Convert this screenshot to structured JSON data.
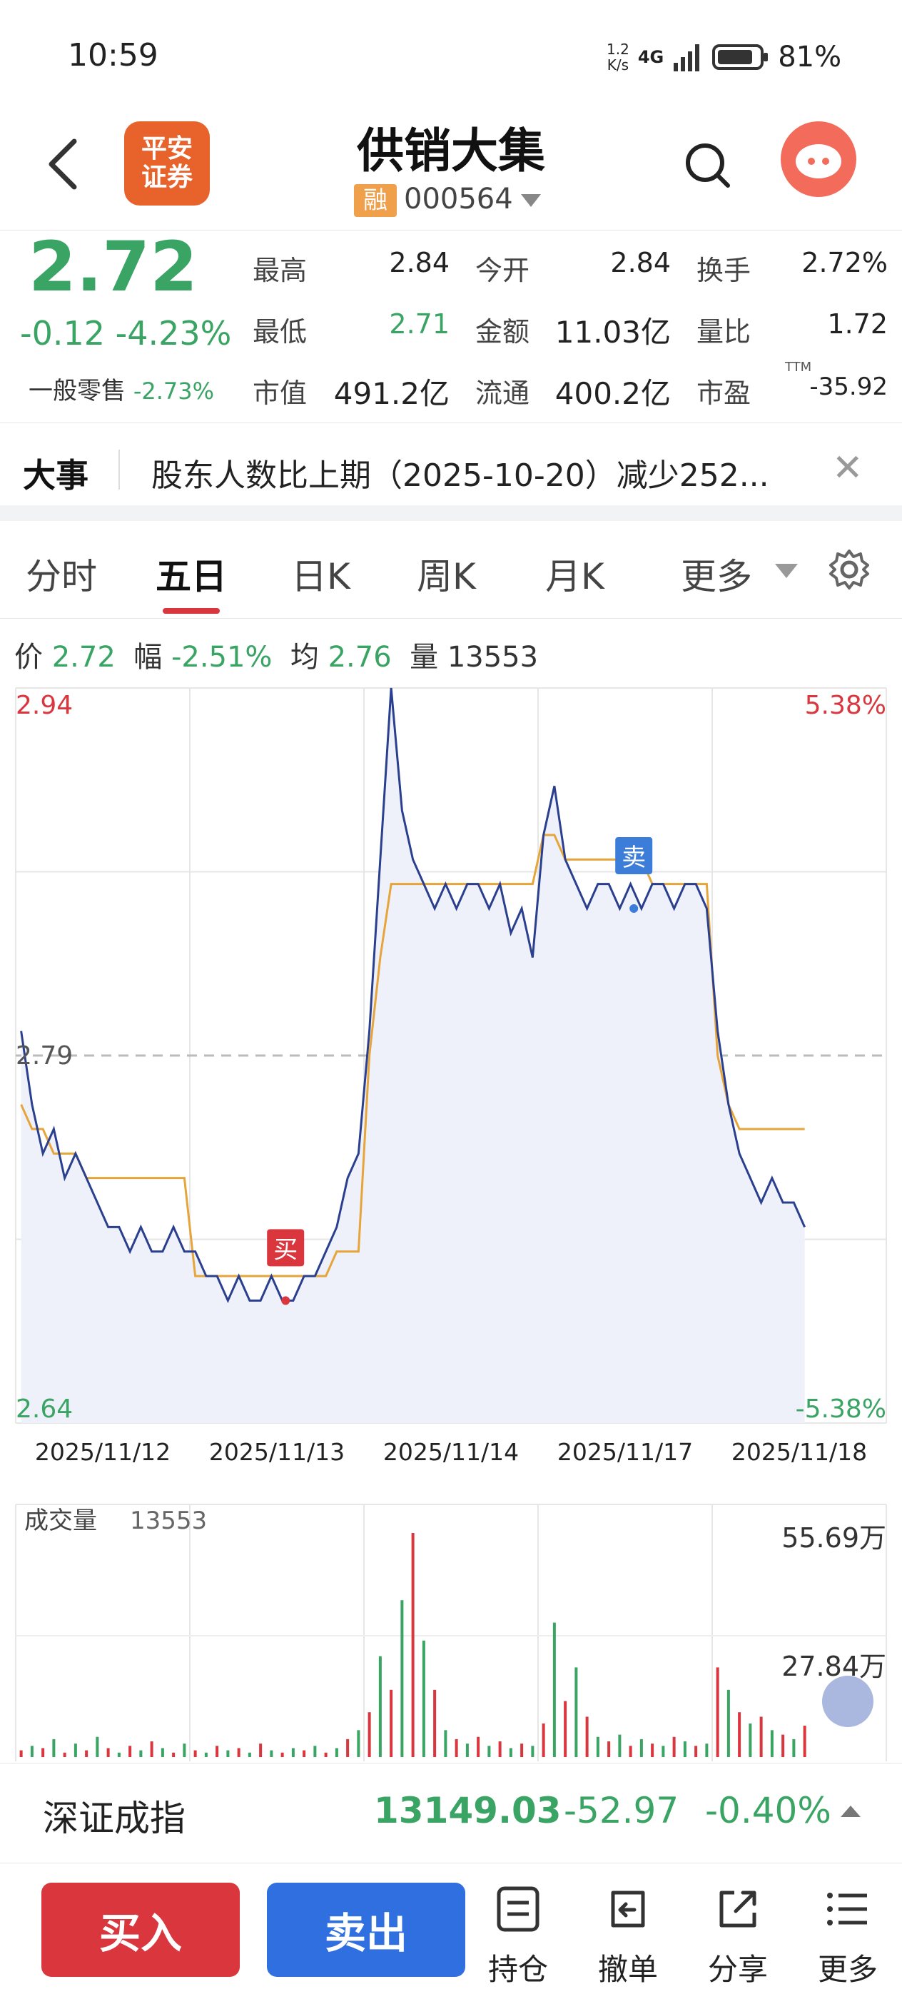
{
  "status_bar": {
    "time": "10:59",
    "net_speed_value": "1.2",
    "net_speed_unit": "K/s",
    "network": "4G",
    "battery": "81%"
  },
  "header": {
    "logo_line1": "平安",
    "logo_line2": "证券",
    "title": "供销大集",
    "badge": "融",
    "code": "000564"
  },
  "quote": {
    "price": "2.72",
    "change": "-0.12",
    "change_pct": "-4.23%",
    "sector_label": "一般零售",
    "sector_pct": "-2.73%",
    "fields": [
      {
        "label": "最高",
        "value": "2.84"
      },
      {
        "label": "今开",
        "value": "2.84"
      },
      {
        "label": "换手",
        "value": "2.72%"
      },
      {
        "label": "最低",
        "value": "2.71"
      },
      {
        "label": "金额",
        "value": "11.03亿"
      },
      {
        "label": "量比",
        "value": "1.72"
      },
      {
        "label": "市值",
        "value": "491.2亿"
      },
      {
        "label": "流通",
        "value": "400.2亿"
      },
      {
        "label": "市盈",
        "value": "-35.92",
        "sup": "TTM"
      }
    ]
  },
  "news": {
    "label": "大事",
    "text": "股东人数比上期（2025-10-20）减少252..."
  },
  "tabs": [
    "分时",
    "五日",
    "日K",
    "周K",
    "月K",
    "更多"
  ],
  "info_row": {
    "price_label": "价",
    "price": "2.72",
    "amp_label": "幅",
    "amp": "-2.51%",
    "avg_label": "均",
    "avg": "2.76",
    "vol_label": "量",
    "vol": "13553"
  },
  "chart_data": {
    "type": "line",
    "title": "",
    "dates": [
      "2025/11/12",
      "2025/11/13",
      "2025/11/14",
      "2025/11/17",
      "2025/11/18"
    ],
    "y_range": [
      2.64,
      2.94
    ],
    "y_max_label": "2.94",
    "y_min_label": "2.64",
    "pct_max_label": "5.38%",
    "pct_min_label": "-5.38%",
    "prev_close": 2.79,
    "prev_close_label": "2.79",
    "price_color": "#2b3f8f",
    "avg_color": "#e6a53a",
    "markers": [
      {
        "label": "买",
        "day": 1,
        "price": 2.69,
        "color": "#d9363e"
      },
      {
        "label": "卖",
        "day": 3,
        "price": 2.85,
        "color": "#3b7dd8"
      }
    ],
    "series": [
      {
        "name": "价",
        "values": [
          [
            2.8,
            2.77,
            2.75,
            2.76,
            2.74,
            2.75,
            2.74,
            2.73,
            2.72,
            2.72,
            2.71,
            2.72,
            2.71,
            2.71,
            2.72,
            2.71
          ],
          [
            2.71,
            2.7,
            2.7,
            2.69,
            2.7,
            2.69,
            2.69,
            2.7,
            2.69,
            2.69,
            2.7,
            2.7,
            2.71,
            2.72,
            2.74,
            2.75
          ],
          [
            2.8,
            2.87,
            2.94,
            2.89,
            2.87,
            2.86,
            2.85,
            2.86,
            2.85,
            2.86,
            2.86,
            2.85,
            2.86,
            2.84,
            2.85,
            2.83
          ],
          [
            2.88,
            2.9,
            2.87,
            2.86,
            2.85,
            2.86,
            2.86,
            2.85,
            2.86,
            2.85,
            2.86,
            2.86,
            2.85,
            2.86,
            2.86,
            2.85
          ],
          [
            2.8,
            2.77,
            2.75,
            2.74,
            2.73,
            2.74,
            2.73,
            2.73,
            2.72
          ]
        ]
      },
      {
        "name": "均",
        "values": [
          [
            2.77,
            2.76,
            2.76,
            2.75,
            2.75,
            2.75,
            2.74,
            2.74,
            2.74,
            2.74,
            2.74,
            2.74,
            2.74,
            2.74,
            2.74,
            2.74
          ],
          [
            2.7,
            2.7,
            2.7,
            2.7,
            2.7,
            2.7,
            2.7,
            2.7,
            2.7,
            2.7,
            2.7,
            2.7,
            2.7,
            2.71,
            2.71,
            2.71
          ],
          [
            2.79,
            2.83,
            2.86,
            2.86,
            2.86,
            2.86,
            2.86,
            2.86,
            2.86,
            2.86,
            2.86,
            2.86,
            2.86,
            2.86,
            2.86,
            2.86
          ],
          [
            2.88,
            2.88,
            2.87,
            2.87,
            2.87,
            2.87,
            2.87,
            2.87,
            2.87,
            2.87,
            2.86,
            2.86,
            2.86,
            2.86,
            2.86,
            2.86
          ],
          [
            2.79,
            2.77,
            2.76,
            2.76,
            2.76,
            2.76,
            2.76,
            2.76,
            2.76
          ]
        ]
      }
    ],
    "volume": {
      "label": "成交量",
      "value": "13553",
      "max_label": "55.69万",
      "mid_label": "27.84万",
      "max": 556900,
      "bars": [
        [
          3,
          5,
          4,
          8,
          2,
          6,
          3,
          9,
          4,
          2,
          5,
          3,
          7,
          4,
          2,
          6
        ],
        [
          3,
          2,
          5,
          3,
          4,
          2,
          6,
          3,
          2,
          4,
          3,
          5,
          2,
          4,
          8,
          12
        ],
        [
          20,
          45,
          30,
          70,
          100,
          52,
          30,
          12,
          8,
          6,
          9,
          5,
          7,
          4,
          6,
          5
        ],
        [
          15,
          60,
          25,
          40,
          18,
          9,
          7,
          10,
          5,
          8,
          6,
          5,
          9,
          7,
          5,
          6
        ],
        [
          40,
          30,
          20,
          15,
          18,
          12,
          10,
          8,
          14
        ]
      ]
    }
  },
  "index_bar": {
    "name": "深证成指",
    "value": "13149.03",
    "change": "-52.97",
    "pct": "-0.40%"
  },
  "bottom_bar": {
    "buy": "买入",
    "sell": "卖出",
    "tools": [
      "持仓",
      "撤单",
      "分享",
      "更多"
    ]
  }
}
